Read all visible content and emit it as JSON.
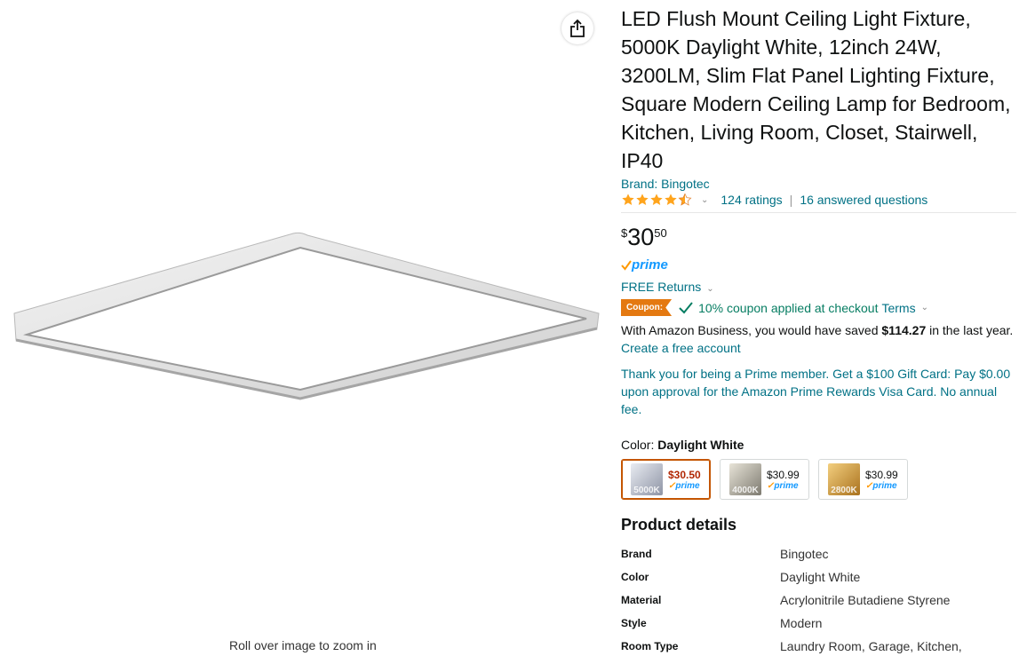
{
  "image_pane": {
    "zoom_hint": "Roll over image to zoom in",
    "share_icon": "share-icon",
    "image_icon": "ceiling-light-image"
  },
  "product": {
    "title": "LED Flush Mount Ceiling Light Fixture, 5000K Daylight White, 12inch 24W, 3200LM, Slim Flat Panel Lighting Fixture, Square Modern Ceiling Lamp for Bedroom, Kitchen, Living Room, Closet, Stairwell, IP40",
    "brand_link": "Brand: Bingotec",
    "rating_value": 4.5,
    "ratings_link": "124 ratings",
    "separator": "|",
    "questions_link": "16 answered questions",
    "price": {
      "symbol": "$",
      "whole": "30",
      "fraction": "50"
    },
    "prime_label": "prime",
    "returns_label": "FREE Returns",
    "coupon": {
      "badge": "Coupon:",
      "text": "10% coupon applied at checkout",
      "terms": "Terms"
    },
    "business": {
      "prefix": "With Amazon Business, you would have saved",
      "amount": "$114.27",
      "suffix": "in the last year.",
      "link": "Create a free account"
    },
    "prime_card_offer": "Thank you for being a Prime member. Get a $100 Gift Card: Pay $0.00 upon approval for the Amazon Prime Rewards Visa Card. No annual fee.",
    "color": {
      "label": "Color:",
      "selected": "Daylight White",
      "options": [
        {
          "badge": "5000K",
          "price": "$30.50",
          "prime": "prime",
          "tint": "#c9ccd6"
        },
        {
          "badge": "4000K",
          "price": "$30.99",
          "prime": "prime",
          "tint": "#bdbab0"
        },
        {
          "badge": "2800K",
          "price": "$30.99",
          "prime": "prime",
          "tint": "#d7a54a"
        }
      ]
    },
    "details": {
      "heading": "Product details",
      "rows": [
        {
          "key": "Brand",
          "value": "Bingotec"
        },
        {
          "key": "Color",
          "value": "Daylight White"
        },
        {
          "key": "Material",
          "value": "Acrylonitrile Butadiene Styrene"
        },
        {
          "key": "Style",
          "value": "Modern"
        },
        {
          "key": "Room Type",
          "value": "Laundry Room, Garage, Kitchen,"
        }
      ]
    }
  },
  "colors": {
    "link": "#007185",
    "star": "#ffa41c",
    "prime_blue": "#1399ff",
    "coupon_orange": "#e47911",
    "coupon_green": "#067d62",
    "selected_border": "#c45500"
  }
}
